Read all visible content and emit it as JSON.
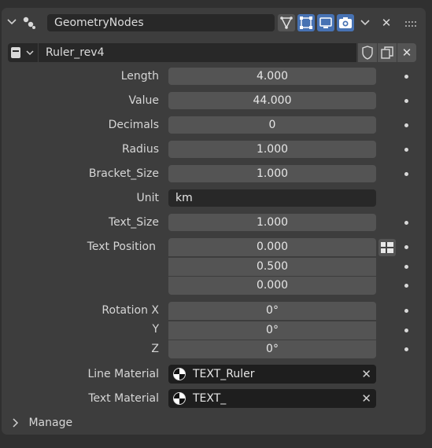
{
  "header": {
    "modifier_name": "GeometryNodes",
    "close_glyph": "✕",
    "toggle_icons": [
      "node-tree-icon",
      "edit-mode-icon",
      "display-icon",
      "render-camera-icon"
    ]
  },
  "node_group": {
    "name": "Ruler_rev4",
    "close_glyph": "✕"
  },
  "properties": [
    {
      "label": "Length",
      "value": "4.000"
    },
    {
      "label": "Value",
      "value": "44.000"
    },
    {
      "label": "Decimals",
      "value": "0"
    },
    {
      "label": "Radius",
      "value": "1.000"
    },
    {
      "label": "Bracket_Size",
      "value": "1.000"
    },
    {
      "label": "Unit",
      "value": "km"
    },
    {
      "label": "Text_Size",
      "value": "1.000"
    }
  ],
  "text_position": {
    "label": "Text Position",
    "values": [
      "0.000",
      "0.500",
      "0.000"
    ]
  },
  "rotation": {
    "labels": [
      "Rotation X",
      "Y",
      "Z"
    ],
    "values": [
      "0°",
      "0°",
      "0°"
    ]
  },
  "materials": [
    {
      "label": "Line Material",
      "value": "TEXT_Ruler",
      "clear": "✕"
    },
    {
      "label": "Text Material",
      "value": "TEXT_",
      "clear": "✕"
    }
  ],
  "manage": {
    "label": "Manage"
  }
}
